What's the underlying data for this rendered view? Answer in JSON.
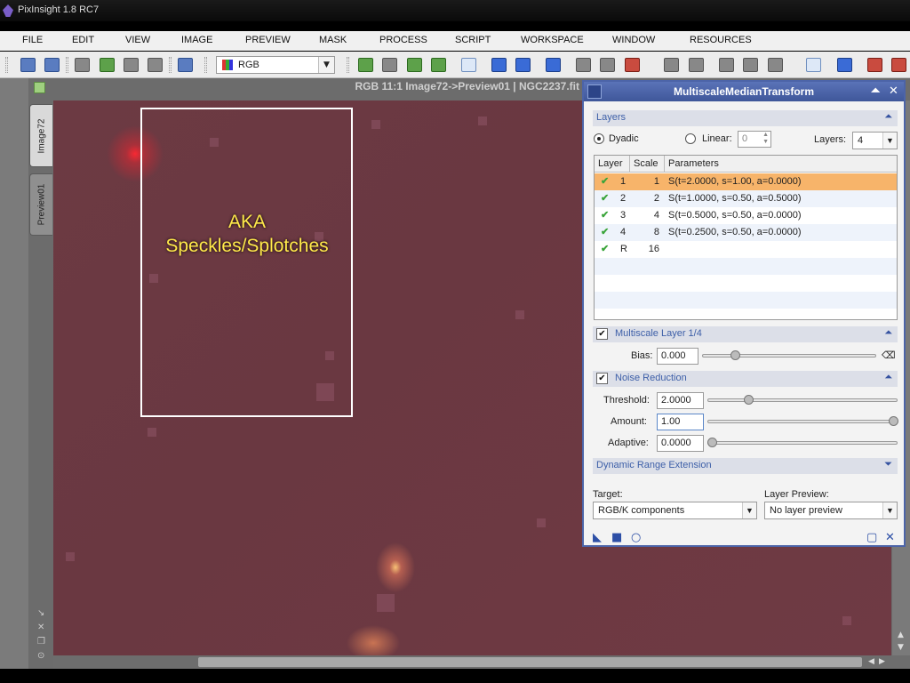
{
  "app": {
    "title": "PixInsight 1.8 RC7"
  },
  "menu": [
    "FILE",
    "EDIT",
    "VIEW",
    "IMAGE",
    "PREVIEW",
    "MASK",
    "PROCESS",
    "SCRIPT",
    "WORKSPACE",
    "WINDOW",
    "RESOURCES"
  ],
  "toolbar": {
    "channel_combo": "RGB"
  },
  "image_window": {
    "title": "RGB 11:1 Image72->Preview01 | NGC2237.fit",
    "tabs": [
      "Image72",
      "Preview01"
    ],
    "annotation_line1": "AKA",
    "annotation_line2": "Speckles/Splotches"
  },
  "mmt": {
    "title": "MultiscaleMedianTransform",
    "layers_section": "Layers",
    "dyadic_label": "Dyadic",
    "linear_label": "Linear:",
    "linear_value": "0",
    "layers_label": "Layers:",
    "layers_value": "4",
    "table_headers": {
      "layer": "Layer",
      "scale": "Scale",
      "params": "Parameters"
    },
    "rows": [
      {
        "check": "✔",
        "layer": "1",
        "scale": "1",
        "params": "S(t=2.0000, s=1.00, a=0.0000)"
      },
      {
        "check": "✔",
        "layer": "2",
        "scale": "2",
        "params": "S(t=1.0000, s=0.50, a=0.5000)"
      },
      {
        "check": "✔",
        "layer": "3",
        "scale": "4",
        "params": "S(t=0.5000, s=0.50, a=0.0000)"
      },
      {
        "check": "✔",
        "layer": "4",
        "scale": "8",
        "params": "S(t=0.2500, s=0.50, a=0.0000)"
      },
      {
        "check": "✔",
        "layer": "R",
        "scale": "16",
        "params": ""
      }
    ],
    "ml_section": "Multiscale Layer 1/4",
    "bias_label": "Bias:",
    "bias_value": "0.000",
    "nr_section": "Noise Reduction",
    "threshold_label": "Threshold:",
    "threshold_value": "2.0000",
    "amount_label": "Amount:",
    "amount_value": "1.00",
    "adaptive_label": "Adaptive:",
    "adaptive_value": "0.0000",
    "dre_section": "Dynamic Range Extension",
    "target_label": "Target:",
    "target_value": "RGB/K components",
    "preview_label": "Layer Preview:",
    "preview_value": "No layer preview"
  },
  "colors": {
    "accent": "#4c64a8",
    "selected_row": "#f7b46a",
    "image_bg": "#6c3a43",
    "annotation": "#ffe94a"
  }
}
